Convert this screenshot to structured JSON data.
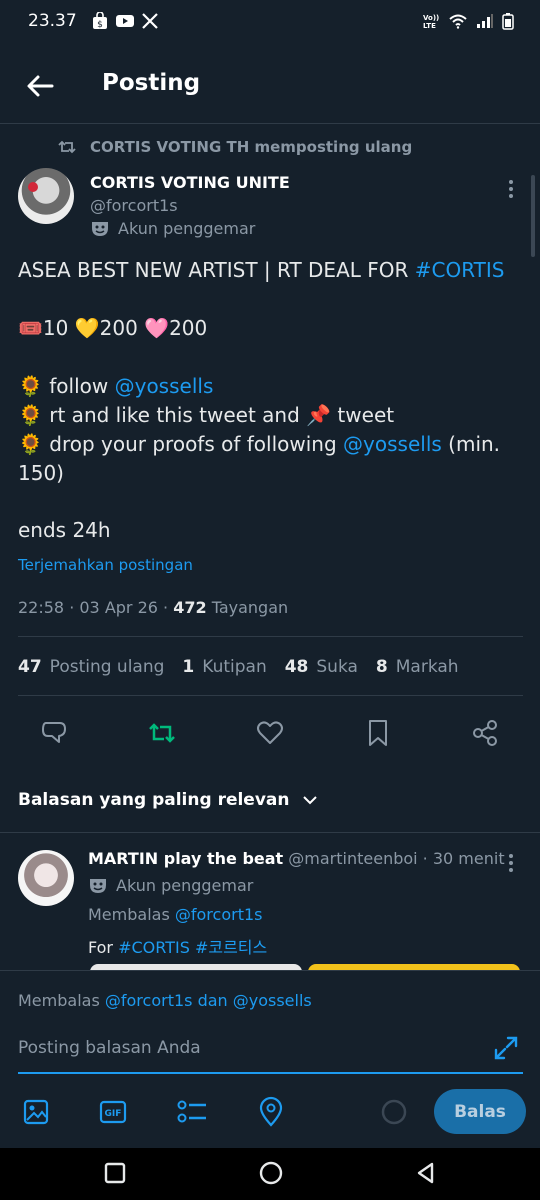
{
  "status_bar": {
    "time": "23.37",
    "network_label": "Vo)) LTE"
  },
  "header": {
    "title": "Posting"
  },
  "repost": {
    "text": "CORTIS VOTING TH memposting ulang"
  },
  "post": {
    "author_name": "CORTIS VOTING UNITE",
    "author_handle": "@forcort1s",
    "badge": "Akun penggemar",
    "line1_text": "ASEA BEST NEW ARTIST | RT DEAL FOR ",
    "line1_hashtag": "#CORTIS",
    "deal_e1": "🎟️",
    "deal_v1": "10",
    "deal_e2": "💛",
    "deal_v2": "200",
    "deal_e3": "🩷",
    "deal_v3": "200",
    "rule_emoji": "🌻",
    "rule1_text": " follow ",
    "rule1_mention": "@yossells",
    "rule2_text": " rt and like this tweet and ",
    "rule2_pin": "📌",
    "rule2_tail": " tweet",
    "rule3_text": " drop your proofs of following ",
    "rule3_mention": "@yossells",
    "rule3_tail": " (min.",
    "rule3_cont": "150)",
    "ends": "ends 24h",
    "translate": "Terjemahkan postingan",
    "meta_prefix": "22:58 · 03 Apr 26 · ",
    "views": "472",
    "views_label": " Tayangan"
  },
  "stats": [
    {
      "num": "47",
      "label": "Posting ulang"
    },
    {
      "num": "1",
      "label": "Kutipan"
    },
    {
      "num": "48",
      "label": "Suka"
    },
    {
      "num": "8",
      "label": "Markah"
    }
  ],
  "sort": {
    "label": "Balasan yang paling relevan"
  },
  "reply": {
    "author_name": "MARTIN play the beat",
    "author_handle": " @martinteenboi",
    "time": " · 30 menit",
    "badge": "Akun penggemar",
    "replying_prefix": "Membalas ",
    "replying_to": "@forcort1s",
    "text_prefix": "For ",
    "hashtags": "#CORTIS #코르티스"
  },
  "composer": {
    "replying_prefix": "Membalas ",
    "replying_users": "@forcort1s dan @yossells",
    "placeholder": "Posting balasan Anda",
    "submit": "Balas"
  },
  "colors": {
    "background": "#15202b",
    "accent": "#1d9bf0",
    "repost_green": "#00ba7c",
    "muted": "#8b98a5"
  }
}
